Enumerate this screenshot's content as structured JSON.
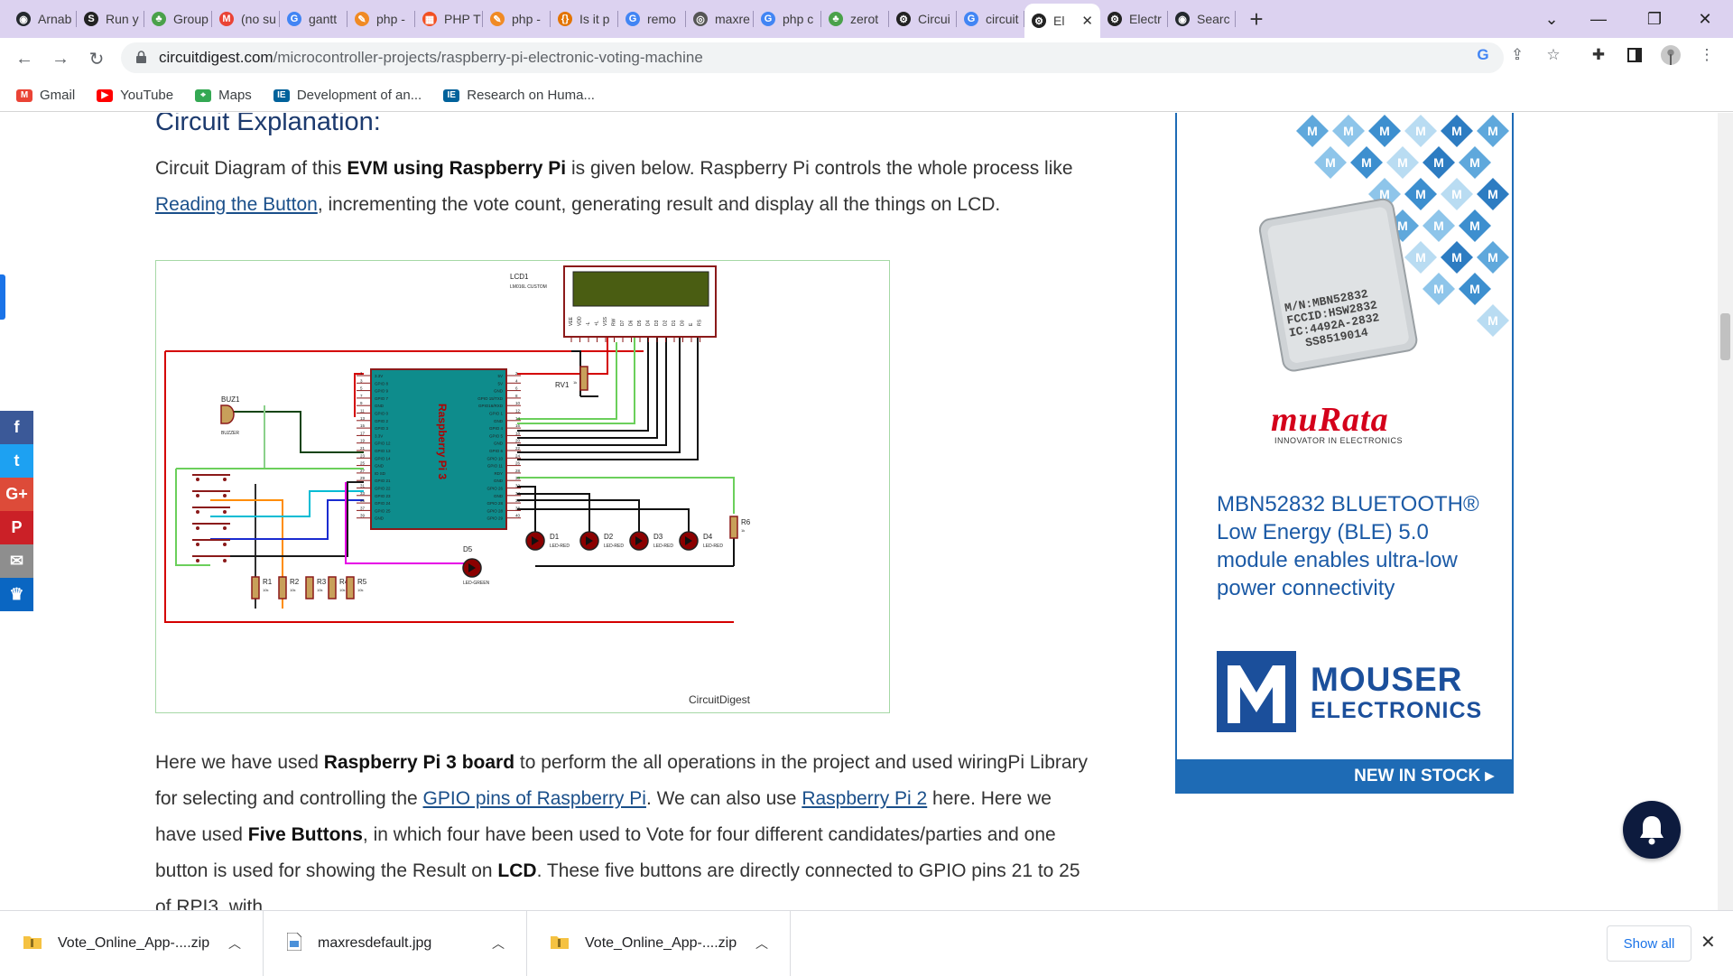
{
  "tabs": [
    {
      "label": "Arnab",
      "icon": "github-icon"
    },
    {
      "label": "Run y",
      "icon": "stackoverflow-icon"
    },
    {
      "label": "Group",
      "icon": "mongodb-leaf-icon"
    },
    {
      "label": "(no su",
      "icon": "gmail-icon"
    },
    {
      "label": "gantt",
      "icon": "google-icon"
    },
    {
      "label": "php -",
      "icon": "php-icon"
    },
    {
      "label": "PHP T",
      "icon": "microsoft-icon"
    },
    {
      "label": "php -",
      "icon": "php-icon"
    },
    {
      "label": "Is it p",
      "icon": "code-braces-icon"
    },
    {
      "label": "remo",
      "icon": "google-icon"
    },
    {
      "label": "maxre",
      "icon": "globe-icon"
    },
    {
      "label": "php c",
      "icon": "google-icon"
    },
    {
      "label": "zerot",
      "icon": "mongodb-leaf-icon"
    },
    {
      "label": "Circui",
      "icon": "circuitdigest-icon"
    },
    {
      "label": "circuit",
      "icon": "google-icon"
    },
    {
      "label": "El",
      "icon": "circuitdigest-icon",
      "active": true
    },
    {
      "label": "Electr",
      "icon": "circuitdigest-icon"
    },
    {
      "label": "Searc",
      "icon": "github-icon"
    }
  ],
  "address": {
    "host": "circuitdigest.com",
    "path": "/microcontroller-projects/raspberry-pi-electronic-voting-machine"
  },
  "bookmarks": [
    {
      "label": "Gmail",
      "icon": "gmail-icon"
    },
    {
      "label": "YouTube",
      "icon": "youtube-icon"
    },
    {
      "label": "Maps",
      "icon": "maps-icon"
    },
    {
      "label": "Development of an...",
      "icon": "ieee-icon"
    },
    {
      "label": "Research on Huma...",
      "icon": "ieee-icon"
    }
  ],
  "article": {
    "heading": "Circuit Explanation:",
    "p1": {
      "t1": "Circuit Diagram of this ",
      "b1": "EVM using Raspberry Pi",
      "t2": " is given below. Raspberry Pi controls the whole process like ",
      "link1": "Reading the Button",
      "t3": ", incrementing the vote count, generating result and display all the things on LCD."
    },
    "p2": {
      "t1": "Here we have used ",
      "b1": "Raspberry Pi 3 board",
      "t2": " to perform the all operations in the project and used wiringPi Library for selecting and controlling the ",
      "link1": "GPIO pins of Raspberry Pi",
      "t3": ". We can also use ",
      "link2": "Raspberry Pi 2",
      "t4": " here.  Here we have used ",
      "b2": "Five Buttons",
      "t5": ", in which four have been used to Vote for four different candidates/parties and one button is used for showing the Result on ",
      "b3": "LCD",
      "t6": ". These five buttons are directly connected to GPIO pins 21 to 25 of RPI3, with"
    }
  },
  "diagram": {
    "lcd_label": "LCD1",
    "lcd_model": "LM016L CUSTOM",
    "lcd_pins": [
      "VEE",
      "VDD",
      "-L",
      "+L",
      "VSS",
      "RW",
      "D7",
      "D6",
      "D5",
      "D4",
      "D3",
      "D2",
      "D1",
      "D0",
      "E",
      "RS"
    ],
    "pi_label": "Raspberry Pi 3",
    "pi_left_pins": [
      "3.3V",
      "GPIO 8",
      "GPIO 9",
      "GPIO 7",
      "GND",
      "GPIO 0",
      "GPIO 2",
      "GPIO 3",
      "3.3V",
      "GPIO 12",
      "GPIO 13",
      "GPIO 14",
      "GND",
      "ID SD",
      "GPIO 21",
      "GPIO 22",
      "GPIO 23",
      "GPIO 24",
      "GPIO 25",
      "GND"
    ],
    "pi_right_pins": [
      "5V",
      "5V",
      "GND",
      "GPIO 15/TXD",
      "GPIO16/RXD",
      "GPIO 1",
      "GND",
      "GPIO 4",
      "GPIO 5",
      "GND",
      "GPIO 6",
      "GPIO 10",
      "GPIO 11",
      "RDY",
      "GND",
      "GPIO 26",
      "GND",
      "GPIO 28",
      "GPIO 28",
      "GPIO 29"
    ],
    "pi_left_nums": [
      "1",
      "3",
      "5",
      "7",
      "9",
      "11",
      "13",
      "15",
      "17",
      "19",
      "21",
      "23",
      "25",
      "27",
      "29",
      "31",
      "33",
      "35",
      "37",
      "39"
    ],
    "pi_right_nums": [
      "2",
      "4",
      "6",
      "8",
      "10",
      "12",
      "14",
      "16",
      "18",
      "20",
      "22",
      "24",
      "26",
      "28",
      "30",
      "32",
      "34",
      "36",
      "38",
      "40"
    ],
    "buzzer_label": "BUZ1",
    "buzzer_type": "BUZZER",
    "rv_label": "RV1",
    "rv_value": "1k",
    "leds": [
      {
        "label": "D1",
        "type": "LED-RED"
      },
      {
        "label": "D2",
        "type": "LED-RED"
      },
      {
        "label": "D3",
        "type": "LED-RED"
      },
      {
        "label": "D4",
        "type": "LED-RED"
      },
      {
        "label": "D5",
        "type": "LED-GREEN"
      }
    ],
    "resistors": [
      {
        "label": "R1",
        "value": "10k"
      },
      {
        "label": "R2",
        "value": "10k"
      },
      {
        "label": "R3",
        "value": "10k"
      },
      {
        "label": "R4",
        "value": "10k"
      },
      {
        "label": "R5",
        "value": "10k"
      },
      {
        "label": "R6",
        "value": "1k"
      }
    ],
    "watermark": "CircuitDigest"
  },
  "ad": {
    "module_marking": [
      "M/N:MBN52832",
      "FCCID:HSW2832",
      "IC:4492A-2832",
      "SS8519014"
    ],
    "brand": "muRata",
    "brand_tagline": "INNOVATOR IN ELECTRONICS",
    "headline": "MBN52832 BLUETOOTH® Low Energy (BLE) 5.0 module enables ultra-low power connectivity",
    "mouser_line1": "MOUSER",
    "mouser_line2": "ELECTRONICS",
    "cta": "NEW IN STOCK ▸",
    "colors": {
      "accent": "#1e6bb5",
      "murata": "#d4001a"
    }
  },
  "social": [
    {
      "icon": "facebook-icon",
      "glyph": "f",
      "color": "#3b5998"
    },
    {
      "icon": "twitter-icon",
      "glyph": "t",
      "color": "#1da1f2"
    },
    {
      "icon": "google-plus-icon",
      "glyph": "G+",
      "color": "#dd4b39"
    },
    {
      "icon": "pinterest-icon",
      "glyph": "P",
      "color": "#cb2027"
    },
    {
      "icon": "email-icon",
      "glyph": "✉",
      "color": "#8e8e8e"
    },
    {
      "icon": "crown-icon",
      "glyph": "♛",
      "color": "#0a66c2"
    }
  ],
  "downloads": [
    {
      "name": "Vote_Online_App-....zip",
      "icon": "zip-folder-icon"
    },
    {
      "name": "maxresdefault.jpg",
      "icon": "image-file-icon"
    },
    {
      "name": "Vote_Online_App-....zip",
      "icon": "zip-folder-icon"
    }
  ],
  "download_bar": {
    "show_all": "Show all",
    "close": "✕"
  },
  "window": {
    "minimize": "—",
    "restore": "❐",
    "close": "✕",
    "tab_search": "⌄",
    "new_tab": "+"
  }
}
